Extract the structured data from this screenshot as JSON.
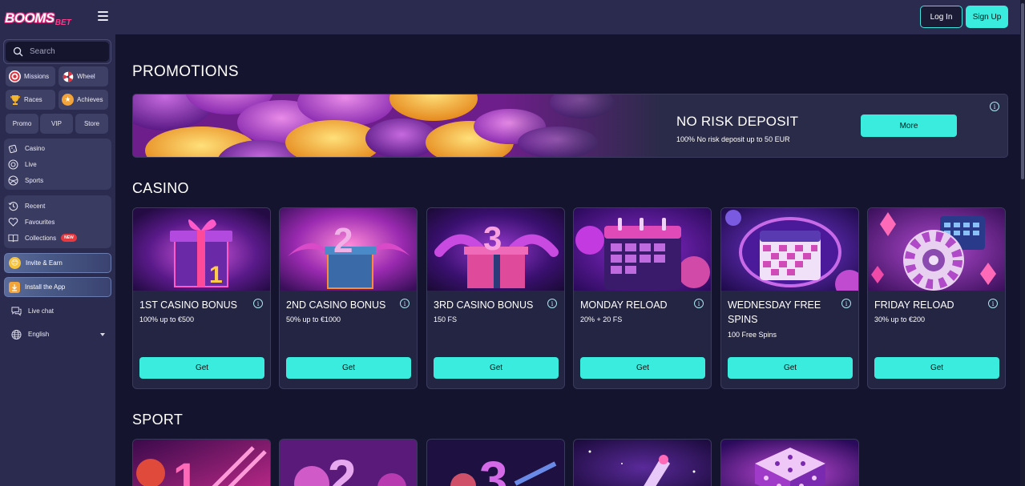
{
  "sidebar": {
    "logo_main": "BOOMS",
    "logo_sub": "BET",
    "search_placeholder": "Search",
    "quick": [
      {
        "label": "Missions",
        "icon": "target-icon"
      },
      {
        "label": "Wheel",
        "icon": "wheel-icon"
      },
      {
        "label": "Races",
        "icon": "trophy-icon"
      },
      {
        "label": "Achieves",
        "icon": "medal-icon"
      }
    ],
    "tabs": [
      "Promo",
      "VIP",
      "Store"
    ],
    "main_nav": [
      "Casino",
      "Live",
      "Sports"
    ],
    "secondary_nav": [
      "Recent",
      "Favourites",
      "Collections"
    ],
    "collections_badge": "NEW",
    "invite_label": "Invite & Earn",
    "install_label": "Install the App",
    "live_chat": "Live chat",
    "language": "English"
  },
  "header": {
    "login_label": "Log In",
    "signup_label": "Sign Up"
  },
  "promotions": {
    "title": "PROMOTIONS",
    "banner": {
      "title": "NO RISK DEPOSIT",
      "description": "100% No risk deposit up to 50 EUR",
      "button": "More"
    }
  },
  "casino": {
    "title": "CASINO",
    "cards": [
      {
        "title": "1ST CASINO BONUS",
        "desc": "100% up to €500",
        "button": "Get"
      },
      {
        "title": "2ND CASINO BONUS",
        "desc": "50% up to €1000",
        "button": "Get"
      },
      {
        "title": "3RD CASINO BONUS",
        "desc": "150 FS",
        "button": "Get"
      },
      {
        "title": "MONDAY RELOAD",
        "desc": "20% + 20 FS",
        "button": "Get"
      },
      {
        "title": "WEDNESDAY FREE SPINS",
        "desc": "100 Free Spins",
        "button": "Get"
      },
      {
        "title": "FRIDAY RELOAD",
        "desc": "30% up to €200",
        "button": "Get"
      }
    ]
  },
  "sport": {
    "title": "SPORT"
  },
  "colors": {
    "accent": "#39ecde",
    "background": "#14142e",
    "panel": "#2a2b4e",
    "card": "#242543",
    "badge": "#e5393f"
  }
}
